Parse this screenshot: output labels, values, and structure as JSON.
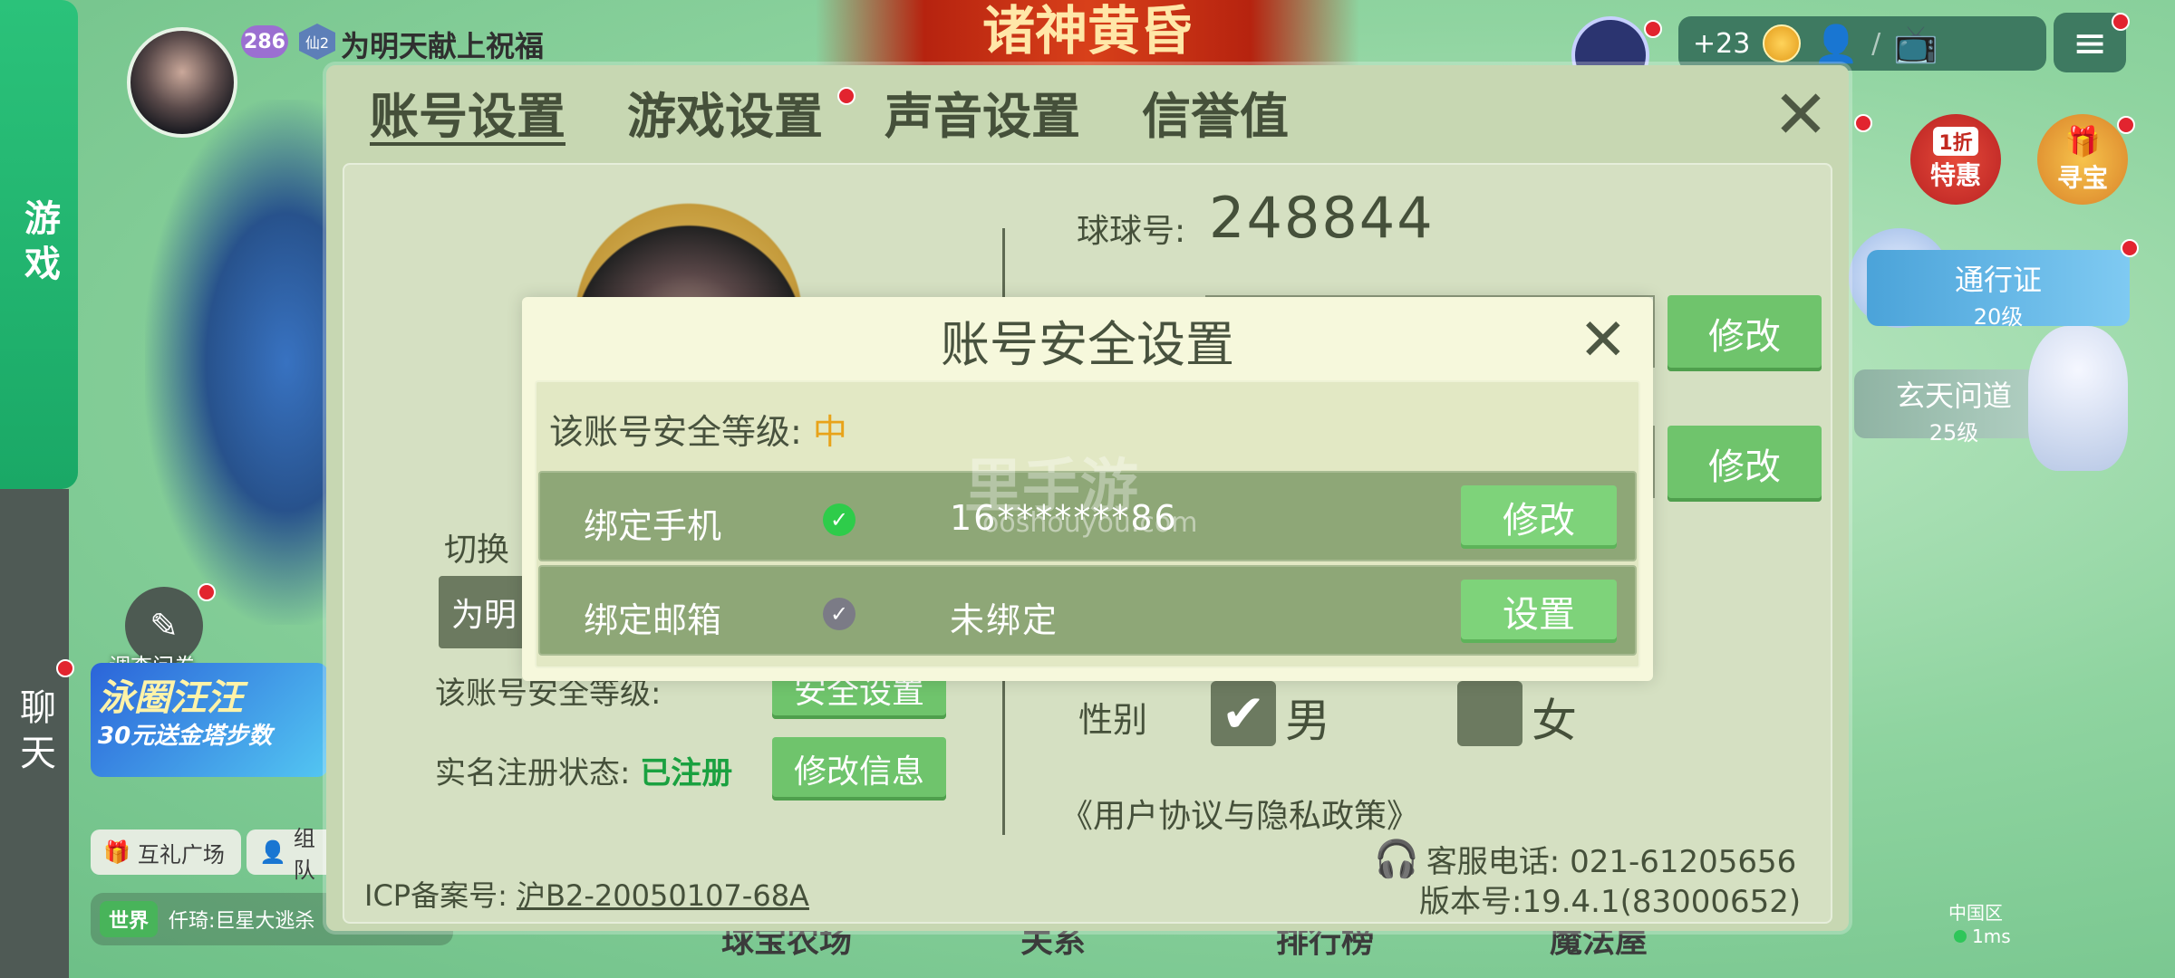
{
  "side_tabs": {
    "game": "游戏",
    "chat": "聊天"
  },
  "lobby": {
    "level": "286",
    "vip": "仙2",
    "user_name": "为明天献上祝福",
    "banner_title": "诸神黄昏",
    "survey_label": "调查问卷",
    "promo_title": "泳圈汪汪",
    "promo_sub": "30元送金塔步数",
    "gift_plaza": "互礼广场",
    "team_partial": "组队",
    "world_tag": "世界",
    "world_msg": "仟琦:巨星大逃杀",
    "plus_count": "+23",
    "sale_label": "特惠",
    "sale_tag": "1折",
    "treasure_label": "寻宝",
    "pass_label": "通行证",
    "pass_level": "20级",
    "dao_label": "玄天问道",
    "dao_level": "25级",
    "bottom_nav": [
      "球宝农场",
      "关系",
      "排行榜",
      "魔法屋"
    ],
    "region": "中国区",
    "ping": "1ms"
  },
  "settings": {
    "tabs": [
      "账号设置",
      "游戏设置",
      "声音设置",
      "信誉值"
    ],
    "qq_label": "球球号:",
    "qq_value": "248844",
    "modify_btn": "修改",
    "switch_label": "切换",
    "switch_value": "为明",
    "security_level_bg": "该账号安全等级:",
    "security_btn_bg": "安全设置",
    "real_name_label": "实名注册状态:",
    "real_name_status": "已注册",
    "modify_info_btn": "修改信息",
    "gender_label": "性别",
    "gender_male": "男",
    "gender_female": "女",
    "policy": "《用户协议与隐私政策》",
    "service_phone": "客服电话: 021-61205656",
    "version": "版本号:19.4.1(83000652)",
    "icp_label": "ICP备案号:",
    "icp_value": "沪B2-20050107-68A"
  },
  "dialog": {
    "title": "账号安全设置",
    "level_label": "该账号安全等级:",
    "level_value": "中",
    "rows": [
      {
        "label": "绑定手机",
        "value": "16*******86",
        "button": "修改",
        "bound": true
      },
      {
        "label": "绑定邮箱",
        "value": "未绑定",
        "button": "设置",
        "bound": false
      }
    ],
    "watermark": "里手游",
    "watermark_url": "ooshouyou.com"
  },
  "colors": {
    "panel": "#c7d7b2",
    "dialog": "#f6f8dc",
    "row": "#8ea777",
    "accent_green": "#6fc46c",
    "level_mid": "#e8a31a",
    "registered": "#1aa140"
  }
}
